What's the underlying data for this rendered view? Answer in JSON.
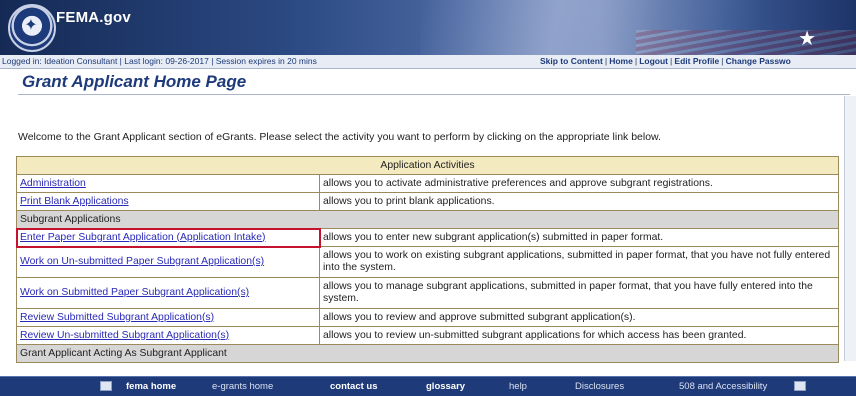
{
  "header": {
    "brand": "FEMA.gov",
    "seal_icon": "dhs-seal-icon",
    "flag_icon": "star-icon"
  },
  "status": {
    "text": "Logged in: Ideation Consultant  |  Last login: 09-26-2017  |  Session expires in 20 mins"
  },
  "topnav": {
    "items": [
      "Skip to Content",
      "Home",
      "Logout",
      "Edit Profile",
      "Change Passwo"
    ]
  },
  "page": {
    "title": "Grant Applicant Home Page",
    "welcome": "Welcome to the Grant Applicant section of eGrants. Please select the activity you want to perform by clicking on the appropriate link below."
  },
  "table": {
    "header": "Application Activities",
    "rows": [
      {
        "link": "Administration",
        "desc": "allows you to activate administrative preferences and approve subgrant registrations."
      },
      {
        "link": "Print Blank Applications",
        "desc": "allows you to print blank applications."
      }
    ],
    "section1": "Subgrant Applications",
    "sub_rows": [
      {
        "link": "Enter Paper Subgrant Application (Application Intake)",
        "desc": "allows you to enter new subgrant application(s) submitted in paper format."
      },
      {
        "link": "Work on Un-submitted Paper Subgrant Application(s)",
        "desc": "allows you to work on existing subgrant applications, submitted in paper format, that you have not fully entered into the system."
      },
      {
        "link": "Work on Submitted Paper Subgrant Application(s)",
        "desc": "allows you to manage subgrant applications, submitted in paper format, that you have fully entered into the system."
      },
      {
        "link": "Review Submitted Subgrant Application(s)",
        "desc": "allows you to review and approve submitted subgrant application(s)."
      },
      {
        "link": "Review Un-submitted Subgrant Application(s)",
        "desc": "allows you to review un-submitted subgrant applications for which access has been granted."
      }
    ],
    "section2": "Grant Applicant Acting As Subgrant Applicant"
  },
  "footer": {
    "items": [
      "fema home",
      "e-grants home",
      "contact us",
      "glossary",
      "help",
      "Disclosures",
      "508 and Accessibility"
    ]
  },
  "colors": {
    "banner": "#2c4a84",
    "link": "#2a2ab8",
    "highlight": "#c4122f",
    "table_header": "#f3eabf",
    "section_row": "#d6d6d6"
  }
}
